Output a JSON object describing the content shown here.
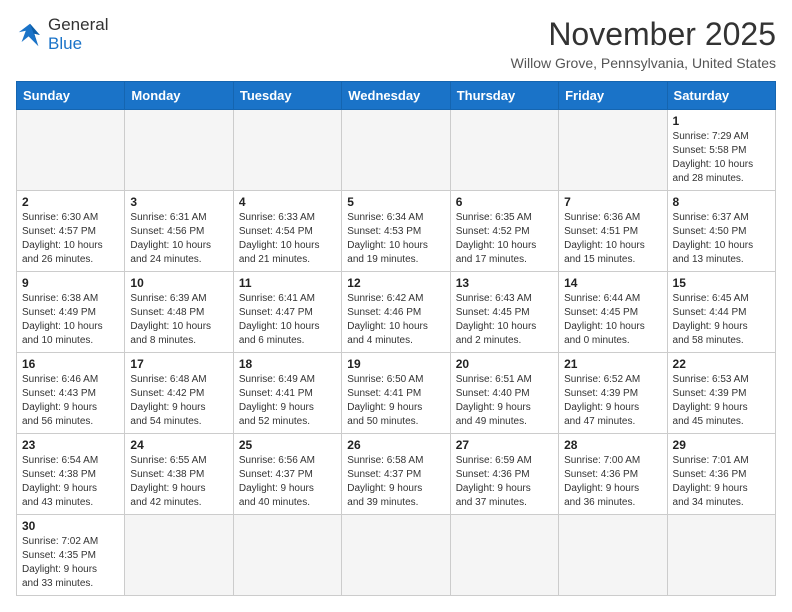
{
  "logo": {
    "general": "General",
    "blue": "Blue"
  },
  "header": {
    "month": "November 2025",
    "location": "Willow Grove, Pennsylvania, United States"
  },
  "weekdays": [
    "Sunday",
    "Monday",
    "Tuesday",
    "Wednesday",
    "Thursday",
    "Friday",
    "Saturday"
  ],
  "weeks": [
    [
      {
        "day": "",
        "info": ""
      },
      {
        "day": "",
        "info": ""
      },
      {
        "day": "",
        "info": ""
      },
      {
        "day": "",
        "info": ""
      },
      {
        "day": "",
        "info": ""
      },
      {
        "day": "",
        "info": ""
      },
      {
        "day": "1",
        "info": "Sunrise: 7:29 AM\nSunset: 5:58 PM\nDaylight: 10 hours\nand 28 minutes."
      }
    ],
    [
      {
        "day": "2",
        "info": "Sunrise: 6:30 AM\nSunset: 4:57 PM\nDaylight: 10 hours\nand 26 minutes."
      },
      {
        "day": "3",
        "info": "Sunrise: 6:31 AM\nSunset: 4:56 PM\nDaylight: 10 hours\nand 24 minutes."
      },
      {
        "day": "4",
        "info": "Sunrise: 6:33 AM\nSunset: 4:54 PM\nDaylight: 10 hours\nand 21 minutes."
      },
      {
        "day": "5",
        "info": "Sunrise: 6:34 AM\nSunset: 4:53 PM\nDaylight: 10 hours\nand 19 minutes."
      },
      {
        "day": "6",
        "info": "Sunrise: 6:35 AM\nSunset: 4:52 PM\nDaylight: 10 hours\nand 17 minutes."
      },
      {
        "day": "7",
        "info": "Sunrise: 6:36 AM\nSunset: 4:51 PM\nDaylight: 10 hours\nand 15 minutes."
      },
      {
        "day": "8",
        "info": "Sunrise: 6:37 AM\nSunset: 4:50 PM\nDaylight: 10 hours\nand 13 minutes."
      }
    ],
    [
      {
        "day": "9",
        "info": "Sunrise: 6:38 AM\nSunset: 4:49 PM\nDaylight: 10 hours\nand 10 minutes."
      },
      {
        "day": "10",
        "info": "Sunrise: 6:39 AM\nSunset: 4:48 PM\nDaylight: 10 hours\nand 8 minutes."
      },
      {
        "day": "11",
        "info": "Sunrise: 6:41 AM\nSunset: 4:47 PM\nDaylight: 10 hours\nand 6 minutes."
      },
      {
        "day": "12",
        "info": "Sunrise: 6:42 AM\nSunset: 4:46 PM\nDaylight: 10 hours\nand 4 minutes."
      },
      {
        "day": "13",
        "info": "Sunrise: 6:43 AM\nSunset: 4:45 PM\nDaylight: 10 hours\nand 2 minutes."
      },
      {
        "day": "14",
        "info": "Sunrise: 6:44 AM\nSunset: 4:45 PM\nDaylight: 10 hours\nand 0 minutes."
      },
      {
        "day": "15",
        "info": "Sunrise: 6:45 AM\nSunset: 4:44 PM\nDaylight: 9 hours\nand 58 minutes."
      }
    ],
    [
      {
        "day": "16",
        "info": "Sunrise: 6:46 AM\nSunset: 4:43 PM\nDaylight: 9 hours\nand 56 minutes."
      },
      {
        "day": "17",
        "info": "Sunrise: 6:48 AM\nSunset: 4:42 PM\nDaylight: 9 hours\nand 54 minutes."
      },
      {
        "day": "18",
        "info": "Sunrise: 6:49 AM\nSunset: 4:41 PM\nDaylight: 9 hours\nand 52 minutes."
      },
      {
        "day": "19",
        "info": "Sunrise: 6:50 AM\nSunset: 4:41 PM\nDaylight: 9 hours\nand 50 minutes."
      },
      {
        "day": "20",
        "info": "Sunrise: 6:51 AM\nSunset: 4:40 PM\nDaylight: 9 hours\nand 49 minutes."
      },
      {
        "day": "21",
        "info": "Sunrise: 6:52 AM\nSunset: 4:39 PM\nDaylight: 9 hours\nand 47 minutes."
      },
      {
        "day": "22",
        "info": "Sunrise: 6:53 AM\nSunset: 4:39 PM\nDaylight: 9 hours\nand 45 minutes."
      }
    ],
    [
      {
        "day": "23",
        "info": "Sunrise: 6:54 AM\nSunset: 4:38 PM\nDaylight: 9 hours\nand 43 minutes."
      },
      {
        "day": "24",
        "info": "Sunrise: 6:55 AM\nSunset: 4:38 PM\nDaylight: 9 hours\nand 42 minutes."
      },
      {
        "day": "25",
        "info": "Sunrise: 6:56 AM\nSunset: 4:37 PM\nDaylight: 9 hours\nand 40 minutes."
      },
      {
        "day": "26",
        "info": "Sunrise: 6:58 AM\nSunset: 4:37 PM\nDaylight: 9 hours\nand 39 minutes."
      },
      {
        "day": "27",
        "info": "Sunrise: 6:59 AM\nSunset: 4:36 PM\nDaylight: 9 hours\nand 37 minutes."
      },
      {
        "day": "28",
        "info": "Sunrise: 7:00 AM\nSunset: 4:36 PM\nDaylight: 9 hours\nand 36 minutes."
      },
      {
        "day": "29",
        "info": "Sunrise: 7:01 AM\nSunset: 4:36 PM\nDaylight: 9 hours\nand 34 minutes."
      }
    ],
    [
      {
        "day": "30",
        "info": "Sunrise: 7:02 AM\nSunset: 4:35 PM\nDaylight: 9 hours\nand 33 minutes."
      },
      {
        "day": "",
        "info": ""
      },
      {
        "day": "",
        "info": ""
      },
      {
        "day": "",
        "info": ""
      },
      {
        "day": "",
        "info": ""
      },
      {
        "day": "",
        "info": ""
      },
      {
        "day": "",
        "info": ""
      }
    ]
  ]
}
